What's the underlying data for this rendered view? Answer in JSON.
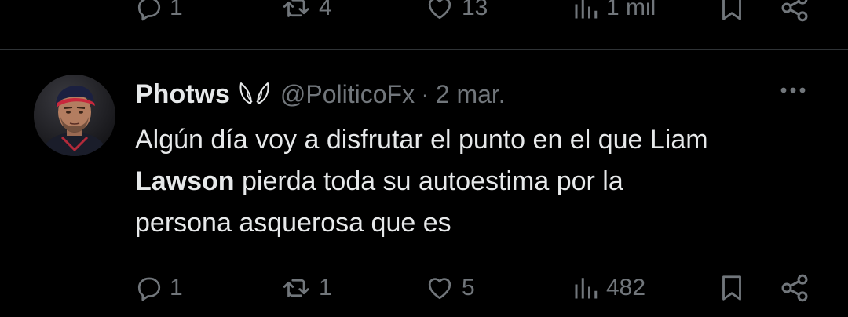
{
  "previous_tweet": {
    "reply_count": "1",
    "repost_count": "4",
    "like_count": "13",
    "view_count": "1 mil"
  },
  "tweet": {
    "display_name": "Photws",
    "handle": "@PoliticoFx",
    "separator": "·",
    "date": "2 mar.",
    "text": {
      "line1": "Algún día voy a disfrutar el punto en el que Liam",
      "line2_bold": "Lawson",
      "line2_rest": " pierda toda su autoestima por la",
      "line3": "persona asquerosa que es"
    },
    "reply_count": "1",
    "repost_count": "1",
    "like_count": "5",
    "view_count": "482"
  },
  "icons": {
    "reply": "reply-icon",
    "repost": "repost-icon",
    "like": "heart-icon",
    "views": "views-icon",
    "bookmark": "bookmark-icon",
    "share": "share-icon",
    "more": "more-icon",
    "name_badge": "wings-icon"
  },
  "colors": {
    "background": "#000000",
    "text_primary": "#e7e9ea",
    "text_secondary": "#71767b",
    "divider": "#2f3336"
  }
}
